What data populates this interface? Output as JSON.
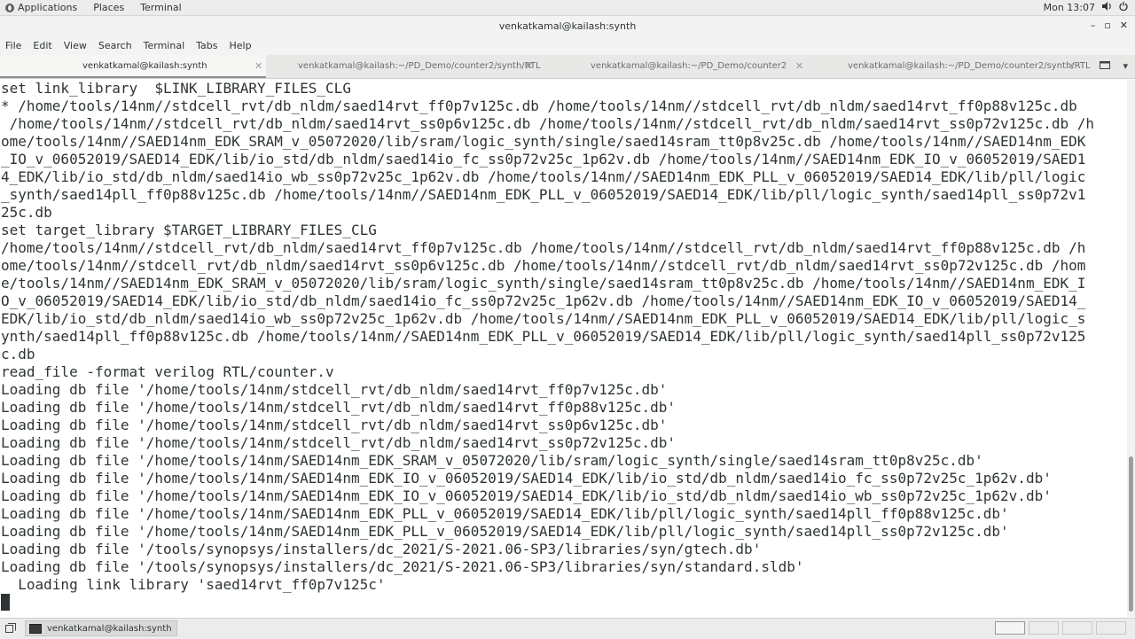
{
  "topbar": {
    "applications": "Applications",
    "places": "Places",
    "terminal": "Terminal",
    "clock": "Mon 13:07"
  },
  "window": {
    "title": "venkatkamal@kailash:synth",
    "minimize": "–",
    "maximize": "▫",
    "close": "✕"
  },
  "menubar": {
    "items": [
      "File",
      "Edit",
      "View",
      "Search",
      "Terminal",
      "Tabs",
      "Help"
    ]
  },
  "tabs": [
    {
      "label": "venkatkamal@kailash:synth",
      "active": true
    },
    {
      "label": "venkatkamal@kailash:~/PD_Demo/counter2/synth/RTL",
      "active": false
    },
    {
      "label": "venkatkamal@kailash:~/PD_Demo/counter2",
      "active": false
    },
    {
      "label": "venkatkamal@kailash:~/PD_Demo/counter2/synth/RTL",
      "active": false
    }
  ],
  "terminal": {
    "lines": [
      "set link_library  $LINK_LIBRARY_FILES_CLG",
      "* /home/tools/14nm//stdcell_rvt/db_nldm/saed14rvt_ff0p7v125c.db /home/tools/14nm//stdcell_rvt/db_nldm/saed14rvt_ff0p88v125c.db",
      " /home/tools/14nm//stdcell_rvt/db_nldm/saed14rvt_ss0p6v125c.db /home/tools/14nm//stdcell_rvt/db_nldm/saed14rvt_ss0p72v125c.db /h",
      "ome/tools/14nm//SAED14nm_EDK_SRAM_v_05072020/lib/sram/logic_synth/single/saed14sram_tt0p8v25c.db /home/tools/14nm//SAED14nm_EDK",
      "_IO_v_06052019/SAED14_EDK/lib/io_std/db_nldm/saed14io_fc_ss0p72v25c_1p62v.db /home/tools/14nm//SAED14nm_EDK_IO_v_06052019/SAED1",
      "4_EDK/lib/io_std/db_nldm/saed14io_wb_ss0p72v25c_1p62v.db /home/tools/14nm//SAED14nm_EDK_PLL_v_06052019/SAED14_EDK/lib/pll/logic",
      "_synth/saed14pll_ff0p88v125c.db /home/tools/14nm//SAED14nm_EDK_PLL_v_06052019/SAED14_EDK/lib/pll/logic_synth/saed14pll_ss0p72v1",
      "25c.db",
      "set target_library $TARGET_LIBRARY_FILES_CLG",
      "/home/tools/14nm//stdcell_rvt/db_nldm/saed14rvt_ff0p7v125c.db /home/tools/14nm//stdcell_rvt/db_nldm/saed14rvt_ff0p88v125c.db /h",
      "ome/tools/14nm//stdcell_rvt/db_nldm/saed14rvt_ss0p6v125c.db /home/tools/14nm//stdcell_rvt/db_nldm/saed14rvt_ss0p72v125c.db /hom",
      "e/tools/14nm//SAED14nm_EDK_SRAM_v_05072020/lib/sram/logic_synth/single/saed14sram_tt0p8v25c.db /home/tools/14nm//SAED14nm_EDK_I",
      "O_v_06052019/SAED14_EDK/lib/io_std/db_nldm/saed14io_fc_ss0p72v25c_1p62v.db /home/tools/14nm//SAED14nm_EDK_IO_v_06052019/SAED14_",
      "EDK/lib/io_std/db_nldm/saed14io_wb_ss0p72v25c_1p62v.db /home/tools/14nm//SAED14nm_EDK_PLL_v_06052019/SAED14_EDK/lib/pll/logic_s",
      "ynth/saed14pll_ff0p88v125c.db /home/tools/14nm//SAED14nm_EDK_PLL_v_06052019/SAED14_EDK/lib/pll/logic_synth/saed14pll_ss0p72v125",
      "c.db",
      "read_file -format verilog RTL/counter.v",
      "Loading db file '/home/tools/14nm/stdcell_rvt/db_nldm/saed14rvt_ff0p7v125c.db'",
      "Loading db file '/home/tools/14nm/stdcell_rvt/db_nldm/saed14rvt_ff0p88v125c.db'",
      "Loading db file '/home/tools/14nm/stdcell_rvt/db_nldm/saed14rvt_ss0p6v125c.db'",
      "Loading db file '/home/tools/14nm/stdcell_rvt/db_nldm/saed14rvt_ss0p72v125c.db'",
      "Loading db file '/home/tools/14nm/SAED14nm_EDK_SRAM_v_05072020/lib/sram/logic_synth/single/saed14sram_tt0p8v25c.db'",
      "Loading db file '/home/tools/14nm/SAED14nm_EDK_IO_v_06052019/SAED14_EDK/lib/io_std/db_nldm/saed14io_fc_ss0p72v25c_1p62v.db'",
      "Loading db file '/home/tools/14nm/SAED14nm_EDK_IO_v_06052019/SAED14_EDK/lib/io_std/db_nldm/saed14io_wb_ss0p72v25c_1p62v.db'",
      "Loading db file '/home/tools/14nm/SAED14nm_EDK_PLL_v_06052019/SAED14_EDK/lib/pll/logic_synth/saed14pll_ff0p88v125c.db'",
      "Loading db file '/home/tools/14nm/SAED14nm_EDK_PLL_v_06052019/SAED14_EDK/lib/pll/logic_synth/saed14pll_ss0p72v125c.db'",
      "Loading db file '/tools/synopsys/installers/dc_2021/S-2021.06-SP3/libraries/syn/gtech.db'",
      "Loading db file '/tools/synopsys/installers/dc_2021/S-2021.06-SP3/libraries/syn/standard.sldb'",
      "  Loading link library 'saed14rvt_ff0p7v125c'"
    ]
  },
  "taskbar": {
    "window_button": "venkatkamal@kailash:synth"
  }
}
